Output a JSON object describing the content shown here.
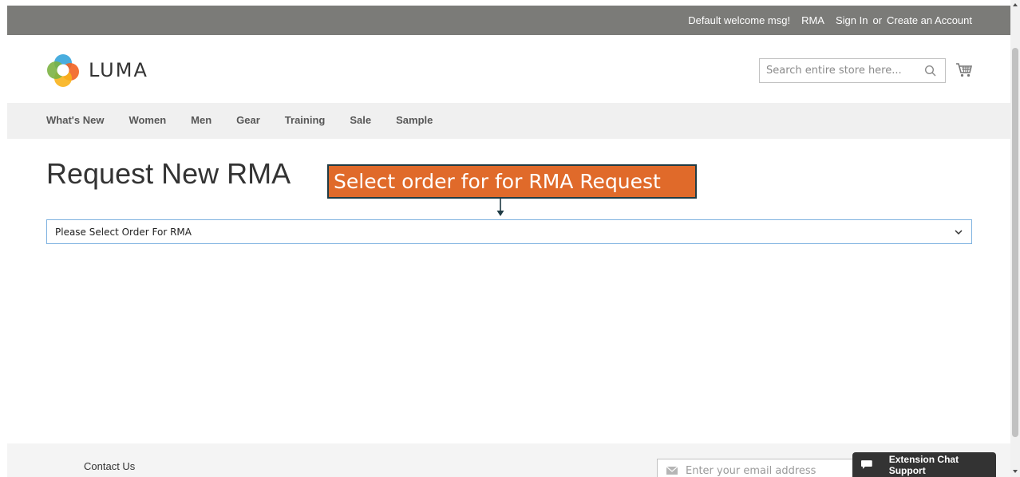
{
  "topbar": {
    "welcome": "Default welcome msg!",
    "rma": "RMA",
    "sign_in": "Sign In",
    "or": "or",
    "create_account": "Create an Account"
  },
  "header": {
    "logo_text": "LUMA",
    "search_placeholder": "Search entire store here..."
  },
  "nav": {
    "items": [
      "What's New",
      "Women",
      "Men",
      "Gear",
      "Training",
      "Sale",
      "Sample"
    ]
  },
  "main": {
    "title": "Request New RMA",
    "callout": "Select order for for RMA Request",
    "select_value": "Please Select Order For RMA"
  },
  "footer": {
    "contact": "Contact Us",
    "newsletter_placeholder": "Enter your email address"
  },
  "chat": {
    "label": "Extension Chat Support"
  },
  "colors": {
    "topbar": "#7b7b78",
    "nav": "#f0f0f0",
    "callout": "#e06a2a",
    "callout_border": "#1f3b44",
    "chat": "#333333"
  }
}
